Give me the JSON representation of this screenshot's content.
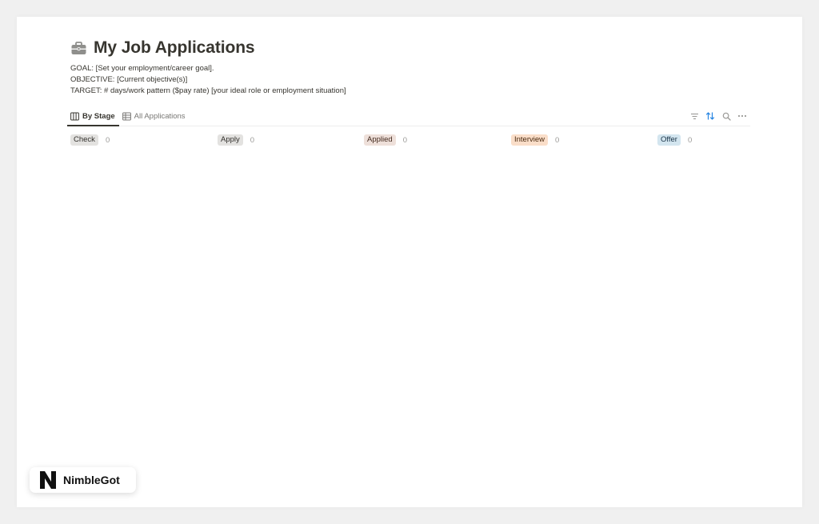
{
  "page": {
    "title": "My Job Applications",
    "icon": "briefcase-icon",
    "description": [
      "GOAL: [Set your employment/career goal].",
      "OBJECTIVE: [Current objective(s)]",
      "TARGET: # days/work pattern ($pay rate) [your ideal role or employment situation]"
    ]
  },
  "views": {
    "tabs": [
      {
        "label": "By Stage",
        "icon": "board-icon",
        "active": true
      },
      {
        "label": "All Applications",
        "icon": "table-icon",
        "active": false
      }
    ],
    "toolbar": [
      "filter-icon",
      "sort-icon",
      "search-icon",
      "more-icon"
    ],
    "accent_color": "#2383e2"
  },
  "board": {
    "columns": [
      {
        "label": "Check",
        "count": "0",
        "bg": "#e3e2e0",
        "fg": "#32302c"
      },
      {
        "label": "Apply",
        "count": "0",
        "bg": "#e3e2e0",
        "fg": "#32302c"
      },
      {
        "label": "Applied",
        "count": "0",
        "bg": "#eee0da",
        "fg": "#442a1e"
      },
      {
        "label": "Interview",
        "count": "0",
        "bg": "#fadec9",
        "fg": "#49290e"
      },
      {
        "label": "Offer",
        "count": "0",
        "bg": "#d3e5ef",
        "fg": "#183347"
      }
    ]
  },
  "watermark": {
    "brand": "NimbleGot"
  }
}
